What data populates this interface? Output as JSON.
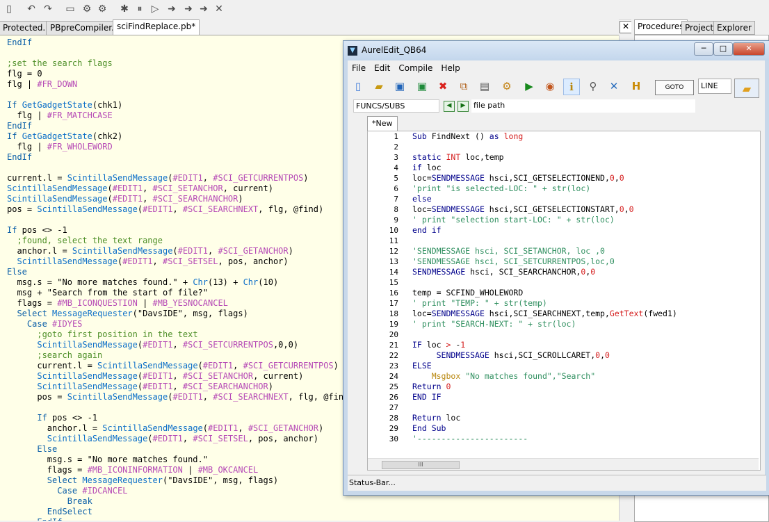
{
  "tabs": [
    "Protected.pb",
    "PBpreCompiler.pb",
    "sciFindReplace.pb*"
  ],
  "right_tabs": [
    "Procedures",
    "Project",
    "Explorer"
  ],
  "window": {
    "title": "AurelEdit_QB64",
    "menu": [
      "File",
      "Edit",
      "Compile",
      "Help"
    ],
    "goto_label": "GOTO",
    "line_label": "LINE",
    "funcs_label": "FUNCS/SUBS",
    "file_path": "file path",
    "doc_tab": "*New",
    "status": "Status-Bar...",
    "scroll_grip": "III"
  }
}
